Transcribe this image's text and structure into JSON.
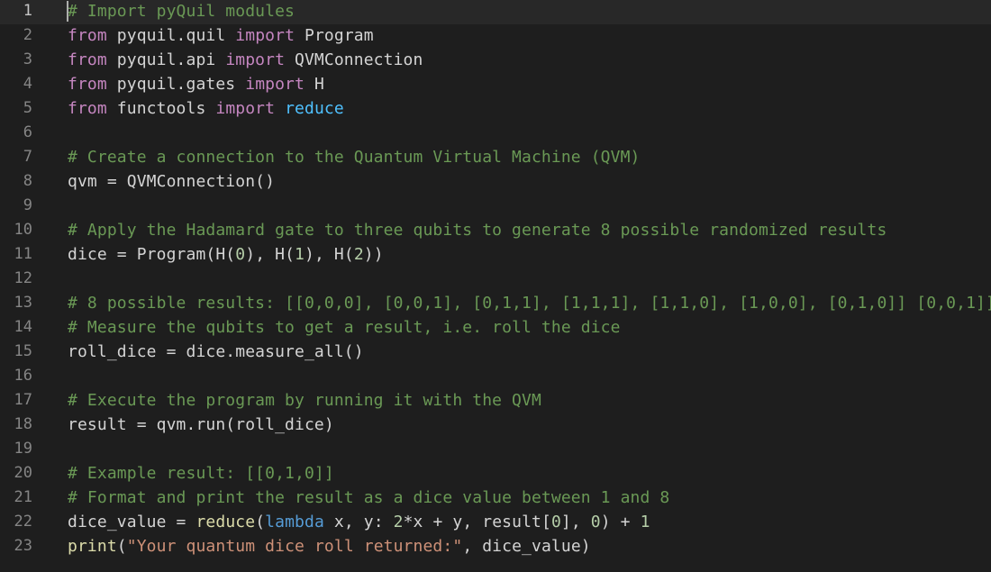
{
  "editor": {
    "language": "python",
    "current_line": 1,
    "lines": [
      {
        "number": "1",
        "tokens": [
          {
            "text": "# Import pyQuil modules",
            "type": "com"
          }
        ]
      },
      {
        "number": "2",
        "tokens": [
          {
            "text": "from",
            "type": "kw"
          },
          {
            "text": " pyquil.quil ",
            "type": "plain"
          },
          {
            "text": "import",
            "type": "kw"
          },
          {
            "text": " Program",
            "type": "plain"
          }
        ]
      },
      {
        "number": "3",
        "tokens": [
          {
            "text": "from",
            "type": "kw"
          },
          {
            "text": " pyquil.api ",
            "type": "plain"
          },
          {
            "text": "import",
            "type": "kw"
          },
          {
            "text": " QVMConnection",
            "type": "plain"
          }
        ]
      },
      {
        "number": "4",
        "tokens": [
          {
            "text": "from",
            "type": "kw"
          },
          {
            "text": " pyquil.gates ",
            "type": "plain"
          },
          {
            "text": "import",
            "type": "kw"
          },
          {
            "text": " H",
            "type": "plain"
          }
        ]
      },
      {
        "number": "5",
        "tokens": [
          {
            "text": "from",
            "type": "kw"
          },
          {
            "text": " functools ",
            "type": "plain"
          },
          {
            "text": "import",
            "type": "kw"
          },
          {
            "text": " ",
            "type": "plain"
          },
          {
            "text": "reduce",
            "type": "fn"
          }
        ]
      },
      {
        "number": "6",
        "tokens": []
      },
      {
        "number": "7",
        "tokens": [
          {
            "text": "# Create a connection to the Quantum Virtual Machine (QVM)",
            "type": "com"
          }
        ]
      },
      {
        "number": "8",
        "tokens": [
          {
            "text": "qvm = QVMConnection()",
            "type": "plain"
          }
        ]
      },
      {
        "number": "9",
        "tokens": []
      },
      {
        "number": "10",
        "tokens": [
          {
            "text": "# Apply the Hadamard gate to three qubits to generate 8 possible randomized results",
            "type": "com"
          }
        ]
      },
      {
        "number": "11",
        "tokens": [
          {
            "text": "dice = Program(H(",
            "type": "plain"
          },
          {
            "text": "0",
            "type": "num"
          },
          {
            "text": "), H(",
            "type": "plain"
          },
          {
            "text": "1",
            "type": "num"
          },
          {
            "text": "), H(",
            "type": "plain"
          },
          {
            "text": "2",
            "type": "num"
          },
          {
            "text": "))",
            "type": "plain"
          }
        ]
      },
      {
        "number": "12",
        "tokens": []
      },
      {
        "number": "13",
        "tokens": [
          {
            "text": "# 8 possible results: [[0,0,0], [0,0,1], [0,1,1], [1,1,1], [1,1,0], [1,0,0], [0,1,0]] [0,0,1]]",
            "type": "com"
          }
        ]
      },
      {
        "number": "14",
        "tokens": [
          {
            "text": "# Measure the qubits to get a result, i.e. roll the dice",
            "type": "com"
          }
        ]
      },
      {
        "number": "15",
        "tokens": [
          {
            "text": "roll_dice = dice.measure_all()",
            "type": "plain"
          }
        ]
      },
      {
        "number": "16",
        "tokens": []
      },
      {
        "number": "17",
        "tokens": [
          {
            "text": "# Execute the program by running it with the QVM",
            "type": "com"
          }
        ]
      },
      {
        "number": "18",
        "tokens": [
          {
            "text": "result = qvm.run(roll_dice)",
            "type": "plain"
          }
        ]
      },
      {
        "number": "19",
        "tokens": []
      },
      {
        "number": "20",
        "tokens": [
          {
            "text": "# Example result: [[0,1,0]]",
            "type": "com"
          }
        ]
      },
      {
        "number": "21",
        "tokens": [
          {
            "text": "# Format and print the result as a dice value between 1 and 8",
            "type": "com"
          }
        ]
      },
      {
        "number": "22",
        "tokens": [
          {
            "text": "dice_value = ",
            "type": "plain"
          },
          {
            "text": "reduce",
            "type": "callfn"
          },
          {
            "text": "(",
            "type": "plain"
          },
          {
            "text": "lambda",
            "type": "lambda"
          },
          {
            "text": " x, y: ",
            "type": "plain"
          },
          {
            "text": "2",
            "type": "num"
          },
          {
            "text": "*x + y, result[",
            "type": "plain"
          },
          {
            "text": "0",
            "type": "num"
          },
          {
            "text": "], ",
            "type": "plain"
          },
          {
            "text": "0",
            "type": "num"
          },
          {
            "text": ") + ",
            "type": "plain"
          },
          {
            "text": "1",
            "type": "num"
          }
        ]
      },
      {
        "number": "23",
        "tokens": [
          {
            "text": "print",
            "type": "callfn"
          },
          {
            "text": "(",
            "type": "plain"
          },
          {
            "text": "\"Your quantum dice roll returned:\"",
            "type": "str"
          },
          {
            "text": ", dice_value)",
            "type": "plain"
          }
        ]
      }
    ]
  }
}
